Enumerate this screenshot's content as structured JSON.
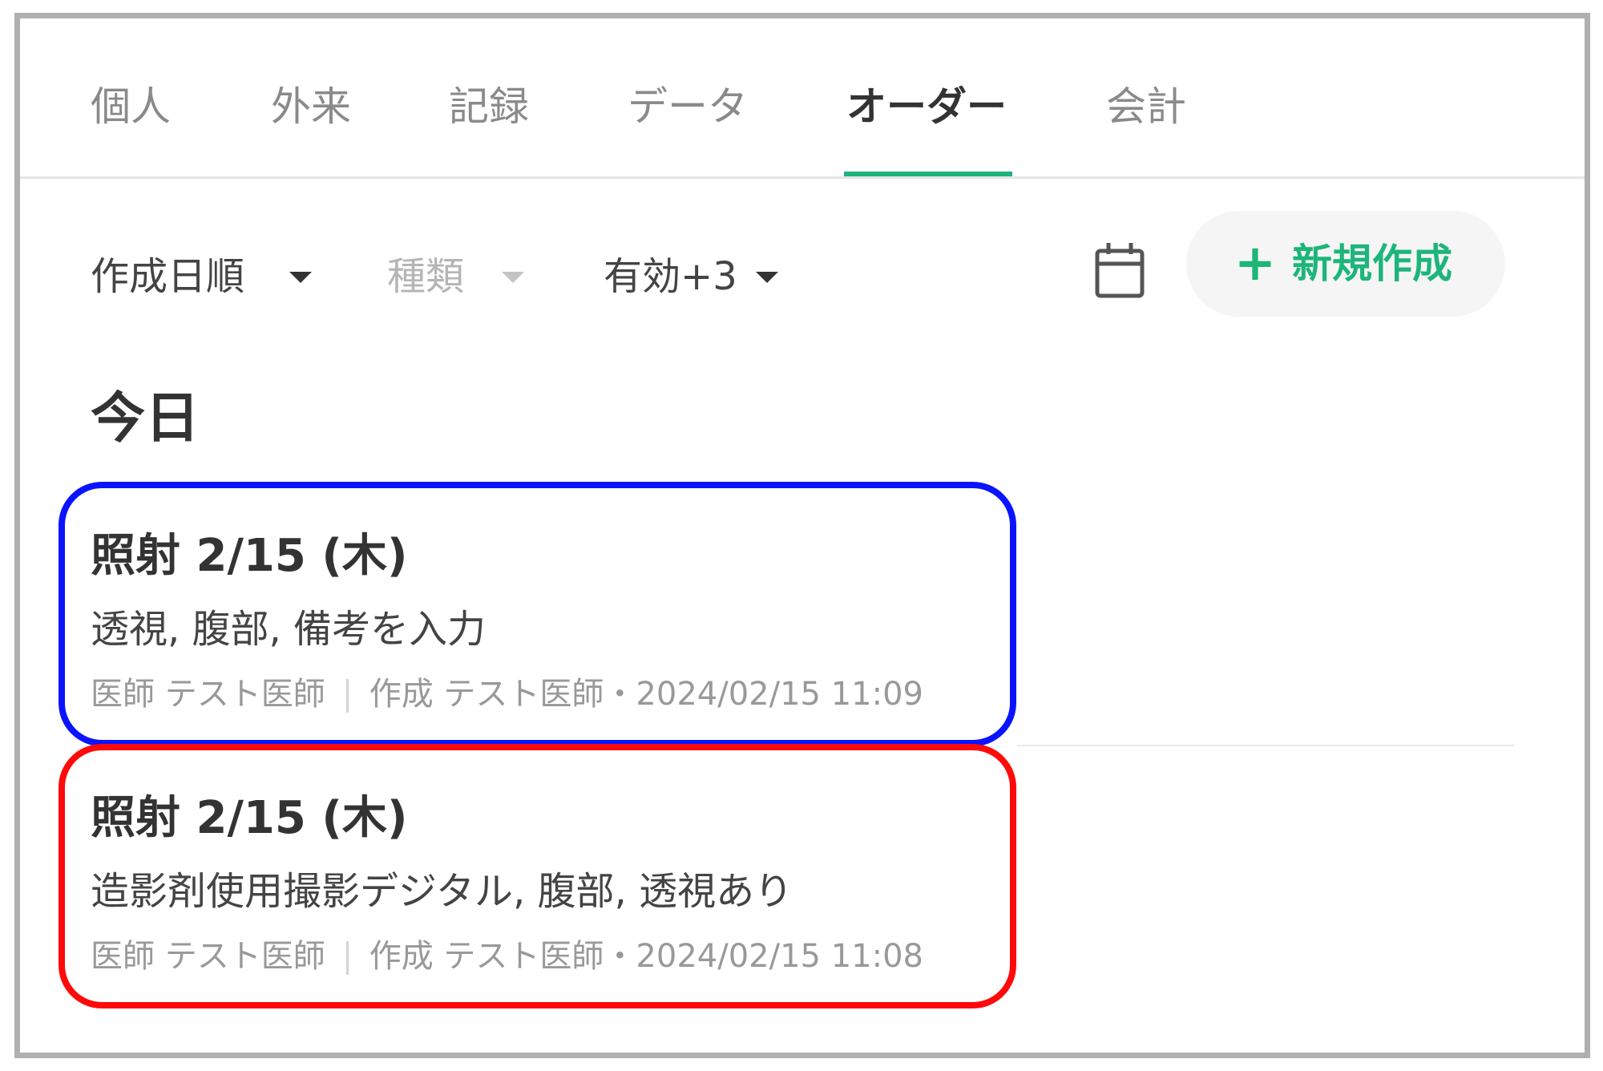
{
  "tabs": [
    {
      "label": "個人"
    },
    {
      "label": "外来"
    },
    {
      "label": "記録"
    },
    {
      "label": "データ"
    },
    {
      "label": "オーダー",
      "active": true
    },
    {
      "label": "会計"
    }
  ],
  "toolbar": {
    "sort_label": "作成日順",
    "type_label": "種類",
    "status_label": "有効+3",
    "calendar_icon": "calendar-icon",
    "new_button_icon": "+",
    "new_button_label": "新規作成"
  },
  "section": {
    "title": "今日"
  },
  "orders": [
    {
      "title": "照射  2/15 (木)",
      "detail": "透視, 腹部, 備考を入力",
      "doctor": "医師 テスト医師",
      "created": "作成 テスト医師・2024/02/15 11:09",
      "highlight_color": "#0a14ff"
    },
    {
      "title": "照射  2/15 (木)",
      "detail": "造影剤使用撮影デジタル, 腹部, 透視あり",
      "doctor": "医師 テスト医師",
      "created": "作成 テスト医師・2024/02/15 11:08",
      "highlight_color": "#ff0a0a"
    }
  ],
  "colors": {
    "accent": "#1db57a",
    "text": "#333333",
    "muted": "#999999"
  }
}
